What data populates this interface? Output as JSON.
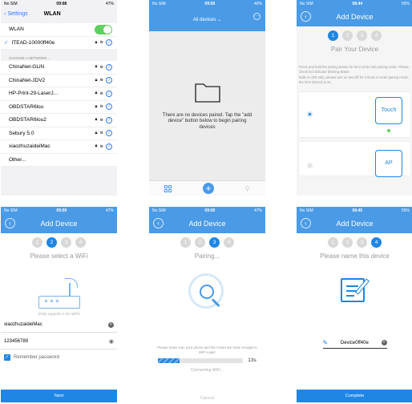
{
  "screen1": {
    "status": {
      "carrier": "No SIM",
      "time": "09:08",
      "battery": "47%"
    },
    "nav": {
      "back": "Settings",
      "title": "WLAN"
    },
    "wlan_label": "WLAN",
    "connected": "ITEAD-10000ff40e",
    "section": "CHOOSE A NETWORK...",
    "networks": [
      "ChinaNet-GLiN",
      "ChinaNet-JDV2",
      "HP-Print-29-LaserJ...",
      "OBDSTAR6lou",
      "OBDSTAR6lou2",
      "Sebury 5.0",
      "xiaozhuzaideiMac",
      "Other..."
    ]
  },
  "screen2": {
    "status": {
      "carrier": "No SIM",
      "time": "09:59",
      "battery": "40%"
    },
    "title": "All devices",
    "empty_text": "There are no devices paired. Tap the \"add device\" button below to begin pairing devices"
  },
  "screen3": {
    "status": {
      "carrier": "No SIM",
      "time": "08:44",
      "battery": "55%"
    },
    "title": "Add Device",
    "steps": [
      "1",
      "2",
      "3",
      "4"
    ],
    "subtitle": "Pair Your Device",
    "instr1": "Press and hold the pairing button for 5s to enter into pairing mode. Please check led indicator blinking status.",
    "instr2": "Bulb or LED strip, please turn on and off for 3 times to enter pairing mode, the time interval is 2s.",
    "mode_touch": "Touch",
    "mode_ap": "AP"
  },
  "screen4": {
    "status": {
      "carrier": "No SIM",
      "time": "09:09",
      "battery": "47%"
    },
    "title": "Add Device",
    "steps": [
      "1",
      "2",
      "3",
      "4"
    ],
    "subtitle": "Please select a WiFi",
    "support": "(Only supports 2.4G WiFi)",
    "ssid": "xiaozhuzaideiMac",
    "password": "123456789",
    "remember": "Remember password",
    "next": "Next"
  },
  "screen5": {
    "status": {
      "carrier": "No SIM",
      "time": "09:09",
      "battery": "47%"
    },
    "title": "Add Device",
    "steps": [
      "1",
      "2",
      "3",
      "4"
    ],
    "subtitle": "Pairing...",
    "note": "Please make sure your phone and the model are close enough to WiFi router",
    "progress_fraction": 0.25,
    "pct": "13s",
    "connecting": "Connecting WiFi...",
    "cancel": "Cancel"
  },
  "screen6": {
    "status": {
      "carrier": "No SIM",
      "time": "08:45",
      "battery": "55%"
    },
    "title": "Add Device",
    "steps": [
      "1",
      "2",
      "3",
      "4"
    ],
    "subtitle": "Please name this device",
    "device_name": "Device0ff40e",
    "complete": "Complete"
  },
  "colors": {
    "primary": "#1f86e4",
    "nav_blue": "#4a9ae6",
    "toggle_green": "#5fcf5f"
  }
}
